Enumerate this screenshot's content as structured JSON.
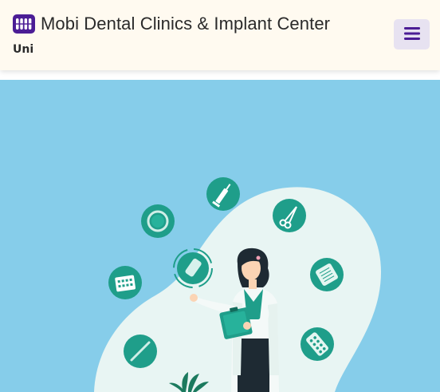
{
  "header": {
    "site_title": "Mobi Dental Clinics & Implant Center",
    "sub_label": "Uni",
    "logo_icon": "teeth-icon",
    "menu_icon": "hamburger-menu-icon",
    "brand_color": "#4b1d95",
    "background": "#fffaf0"
  },
  "hero": {
    "background": "#86cdea",
    "blob_color": "#e8f5f3",
    "accent_color": "#1f9e8a",
    "illustration": "dentist-illustration",
    "floating_icons": [
      "syringe-icon",
      "forceps-icon",
      "ring-icon",
      "tooth-icon",
      "pill-pack-icon",
      "calendar-icon",
      "scalpel-icon",
      "blister-pack-icon"
    ]
  }
}
